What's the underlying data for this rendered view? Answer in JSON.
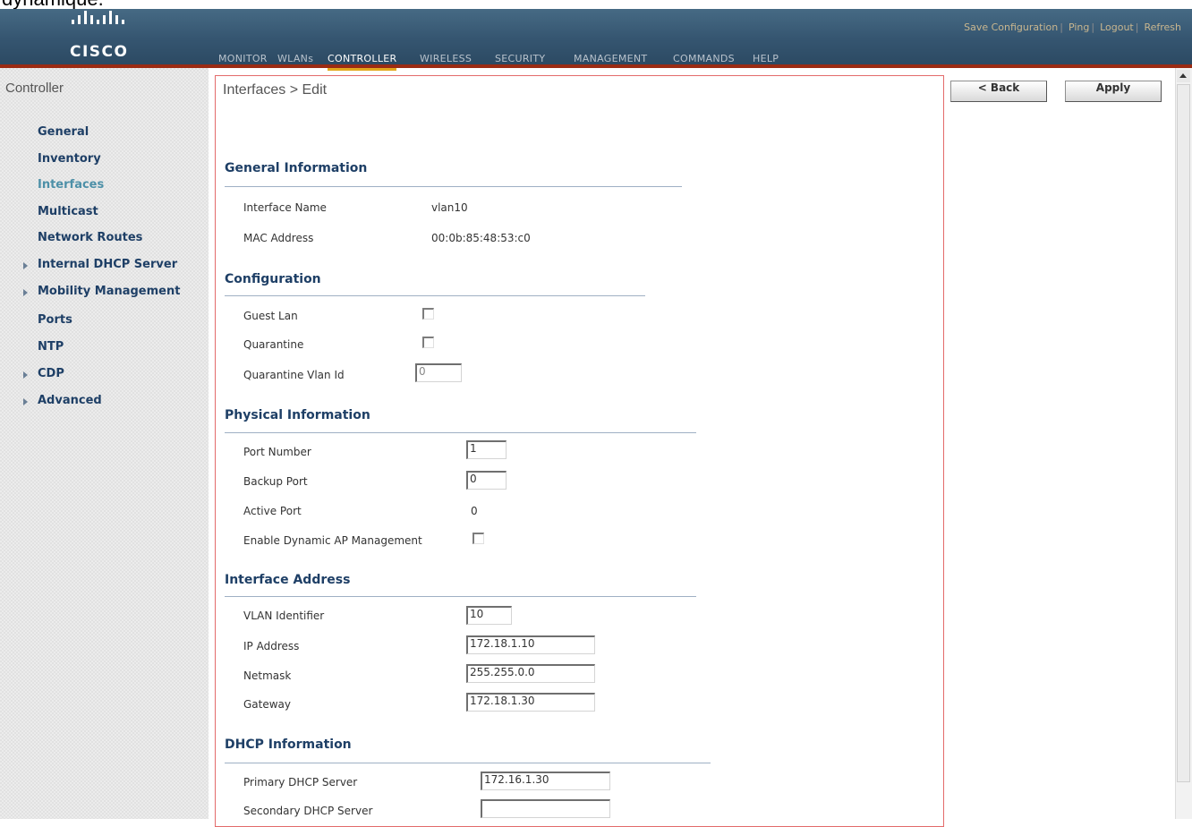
{
  "top_text": "dynamique.",
  "brand": {
    "logo_text": "CISCO"
  },
  "top_links": [
    "Save Configuration",
    "Ping",
    "Logout",
    "Refresh"
  ],
  "nav": [
    "MONITOR",
    "WLANs",
    "CONTROLLER",
    "WIRELESS",
    "SECURITY",
    "MANAGEMENT",
    "COMMANDS",
    "HELP"
  ],
  "nav_active": "CONTROLLER",
  "sidebar": {
    "title": "Controller",
    "items": [
      {
        "label": "General",
        "expandable": false
      },
      {
        "label": "Inventory",
        "expandable": false
      },
      {
        "label": "Interfaces",
        "expandable": false,
        "current": true
      },
      {
        "label": "Multicast",
        "expandable": false
      },
      {
        "label": "Network Routes",
        "expandable": false
      },
      {
        "label": "Internal DHCP Server",
        "expandable": true
      },
      {
        "label": "Mobility Management",
        "expandable": true
      },
      {
        "label": "Ports",
        "expandable": false
      },
      {
        "label": "NTP",
        "expandable": false
      },
      {
        "label": "CDP",
        "expandable": true
      },
      {
        "label": "Advanced",
        "expandable": true
      }
    ]
  },
  "page": {
    "title": "Interfaces > Edit",
    "back_label": "< Back",
    "apply_label": "Apply"
  },
  "general_info": {
    "title": "General Information",
    "interface_name_label": "Interface Name",
    "interface_name": "vlan10",
    "mac_label": "MAC Address",
    "mac": "00:0b:85:48:53:c0"
  },
  "configuration": {
    "title": "Configuration",
    "guest_lan_label": "Guest Lan",
    "guest_lan_checked": false,
    "quarantine_label": "Quarantine",
    "quarantine_checked": false,
    "quarantine_vlan_label": "Quarantine Vlan Id",
    "quarantine_vlan_value": "0"
  },
  "physical": {
    "title": "Physical Information",
    "port_number_label": "Port Number",
    "port_number": "1",
    "backup_port_label": "Backup Port",
    "backup_port": "0",
    "active_port_label": "Active Port",
    "active_port": "0",
    "dyn_ap_label": "Enable Dynamic AP Management",
    "dyn_ap_checked": false
  },
  "iface_address": {
    "title": "Interface Address",
    "vlan_id_label": "VLAN Identifier",
    "vlan_id": "10",
    "ip_label": "IP Address",
    "ip": "172.18.1.10",
    "netmask_label": "Netmask",
    "netmask": "255.255.0.0",
    "gateway_label": "Gateway",
    "gateway": "172.18.1.30"
  },
  "dhcp": {
    "title": "DHCP Information",
    "primary_label": "Primary DHCP Server",
    "primary": "172.16.1.30",
    "secondary_label": "Secondary DHCP Server",
    "secondary": ""
  }
}
